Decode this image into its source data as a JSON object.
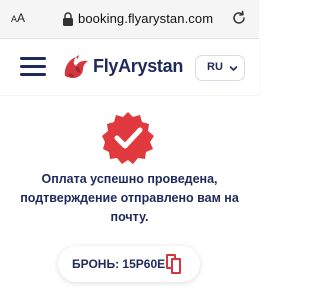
{
  "browser": {
    "text_size_label": "AA",
    "url": "booking.flyarystan.com"
  },
  "header": {
    "brand": "FlyArystan",
    "language": "RU",
    "colors": {
      "navy": "#1f2a5a",
      "brand_red": "#d4373d"
    }
  },
  "confirmation": {
    "message": "Оплата успешно проведена, подтверждение отправлено вам на почту.",
    "booking_label": "БРОНЬ: 15Р60Е"
  },
  "icons": [
    "lock-icon",
    "reload-icon",
    "menu-icon",
    "fox-logo-icon",
    "chevron-down-icon",
    "success-check-icon",
    "copy-icon"
  ]
}
